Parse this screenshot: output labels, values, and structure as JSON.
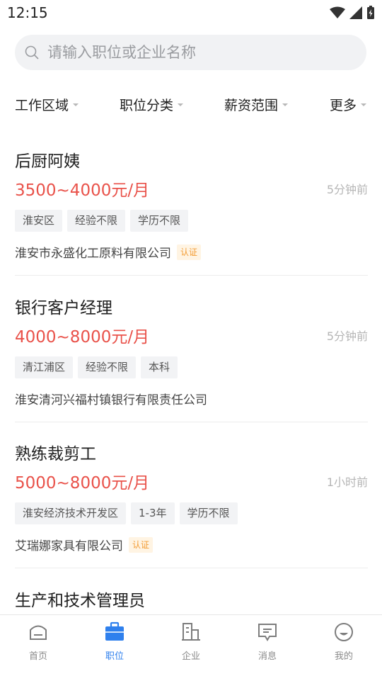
{
  "status_bar": {
    "time": "12:15"
  },
  "search": {
    "placeholder": "请输入职位或企业名称"
  },
  "filters": [
    {
      "label": "工作区域"
    },
    {
      "label": "职位分类"
    },
    {
      "label": "薪资范围"
    },
    {
      "label": "更多"
    }
  ],
  "jobs": [
    {
      "title": "后厨阿姨",
      "salary": "3500~4000元/月",
      "time": "5分钟前",
      "tags": [
        "淮安区",
        "经验不限",
        "学历不限"
      ],
      "company": "淮安市永盛化工原料有限公司",
      "certified": "认证"
    },
    {
      "title": "银行客户经理",
      "salary": "4000~8000元/月",
      "time": "5分钟前",
      "tags": [
        "清江浦区",
        "经验不限",
        "本科"
      ],
      "company": "淮安清河兴福村镇银行有限责任公司",
      "certified": ""
    },
    {
      "title": "熟练裁剪工",
      "salary": "5000~8000元/月",
      "time": "1小时前",
      "tags": [
        "淮安经济技术开发区",
        "1-3年",
        "学历不限"
      ],
      "company": "艾瑞娜家具有限公司",
      "certified": "认证"
    },
    {
      "title": "生产和技术管理员"
    }
  ],
  "tabs": [
    {
      "label": "首页",
      "icon": "home-icon"
    },
    {
      "label": "职位",
      "icon": "briefcase-icon",
      "active": true
    },
    {
      "label": "企业",
      "icon": "building-icon"
    },
    {
      "label": "消息",
      "icon": "message-icon"
    },
    {
      "label": "我的",
      "icon": "profile-icon"
    }
  ],
  "colors": {
    "accent": "#2f80ed",
    "salary": "#e9524a",
    "cert": "#f39c34"
  }
}
